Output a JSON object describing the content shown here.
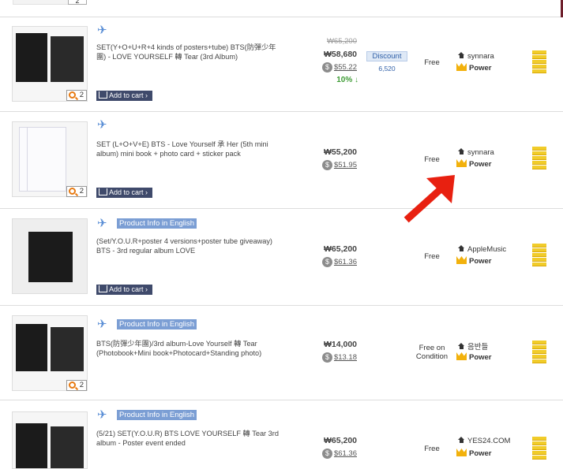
{
  "top": {
    "badge": "2"
  },
  "rows": [
    {
      "zoom": "2",
      "english": "",
      "title": "SET(Y+O+U+R+4 kinds of posters+tube) BTS(防彈少年團) - LOVE YOURSELF 轉 Tear (3rd Album)",
      "cart": "Add to cart ›",
      "old_price": "₩65,200",
      "price": "₩58,680",
      "usd": "$55.22",
      "percent": "10%",
      "discount": "Discount",
      "discount_amount": "6,520",
      "shipping": "Free",
      "seller": "synnara",
      "power": "Power"
    },
    {
      "zoom": "2",
      "english": "",
      "title": "SET (L+O+V+E) BTS - Love Yourself 承 Her (5th mini album) mini book + photo card + sticker pack",
      "cart": "Add to cart ›",
      "price": "₩55,200",
      "usd": "$51.95",
      "shipping": "Free",
      "seller": "synnara",
      "power": "Power"
    },
    {
      "zoom": "",
      "english": "Product Info in English",
      "title": "(Set/Y.O.U.R+poster 4 versions+poster tube giveaway) BTS - 3rd regular album LOVE",
      "cart": "Add to cart ›",
      "price": "₩65,200",
      "usd": "$61.36",
      "shipping": "Free",
      "seller": "AppleMusic",
      "power": "Power"
    },
    {
      "zoom": "2",
      "english": "Product Info in English",
      "title": "BTS(防彈少年團)/3rd album-Love Yourself 轉 Tear (Photobook+Mini book+Photocard+Standing photo)",
      "price": "₩14,000",
      "usd": "$13.18",
      "shipping": "Free on Condition",
      "seller": "음반들",
      "power": "Power"
    },
    {
      "zoom": "",
      "english": "Product Info in English",
      "title": "(5/21) SET(Y.O.U.R) BTS LOVE YOURSELF 轉 Tear 3rd album - Poster event ended",
      "price": "₩65,200",
      "usd": "$61.36",
      "shipping": "Free",
      "seller": "YES24.COM",
      "power": "Power"
    }
  ],
  "icons": {
    "plane": "airplane-icon",
    "zoom": "magnifier-icon",
    "cart": "cart-icon",
    "coin": "dollar-coin-icon",
    "seller": "house-icon",
    "power": "crown-icon",
    "bars": "gold-bars-icon",
    "arrow": "red-arrow-annotation"
  },
  "colors": {
    "accent_blue": "#7b9ed4",
    "cart_bg": "#3f4a6b",
    "discount_green": "#3e9b35",
    "gold": "#f1cc2a",
    "arrow_red": "#e82010"
  }
}
